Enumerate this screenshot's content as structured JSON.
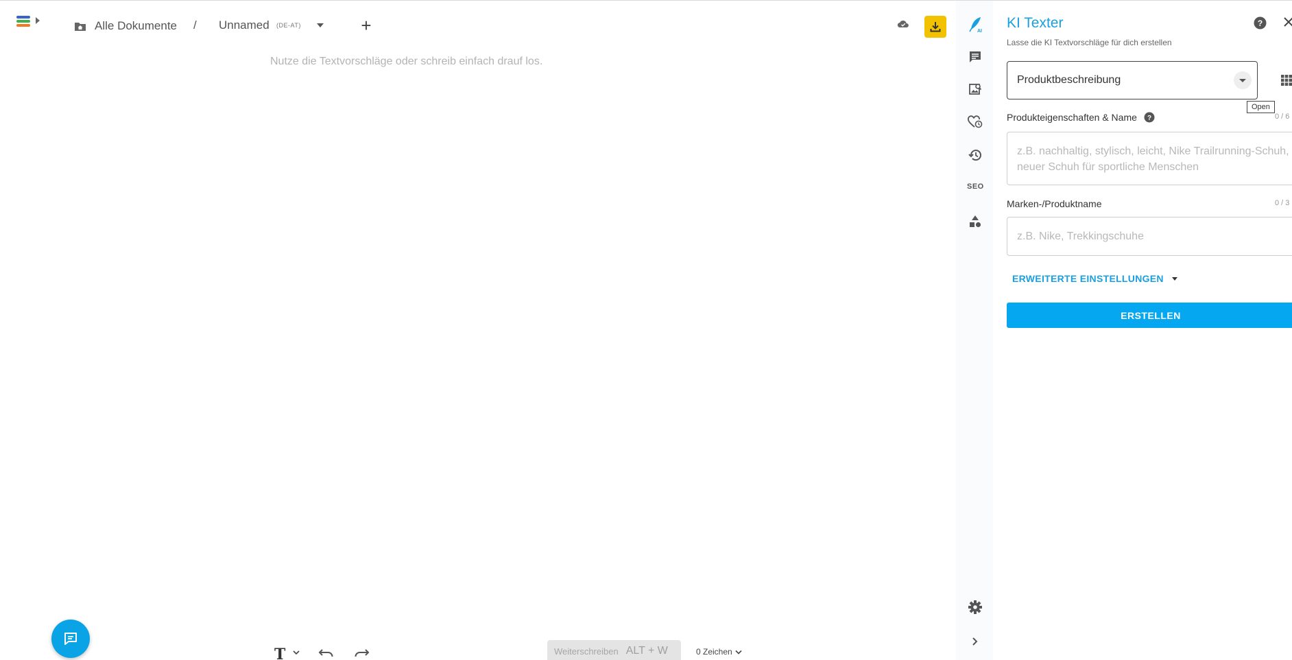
{
  "header": {
    "breadcrumb_root": "Alle Dokumente",
    "breadcrumb_separator": "/",
    "document_name": "Unnamed",
    "document_language": "(DE-AT)",
    "add_label": "+"
  },
  "editor": {
    "placeholder": "Nutze die Textvorschläge oder schreib einfach drauf los."
  },
  "bottom_bar": {
    "text_format_label": "T",
    "continue_label": "Weiterschreiben",
    "continue_shortcut": "ALT + W",
    "char_count": "0 Zeichen"
  },
  "rail": {
    "seo_label": "SEO"
  },
  "panel": {
    "title": "KI Texter",
    "subtitle": "Lasse die KI Textvorschläge für dich erstellen",
    "template_select": "Produktbeschreibung",
    "tooltip": "Open",
    "field1_label": "Produkteigenschaften & Name",
    "field1_counter": "0 / 6",
    "field1_placeholder": "z.B. nachhaltig, stylisch, leicht, Nike Trailrunning-Schuh, neuer Schuh für sportliche Menschen",
    "field2_label": "Marken-/Produktname",
    "field2_counter": "0 / 3",
    "field2_placeholder": "z.B. Nike, Trekkingschuhe",
    "advanced_settings": "ERWEITERTE EINSTELLUNGEN",
    "create_button": "ERSTELLEN"
  },
  "colors": {
    "accent": "#1a9fe0",
    "primary_button": "#05a8f0",
    "download_button": "#f2c200",
    "fab": "#0aa3e6"
  }
}
